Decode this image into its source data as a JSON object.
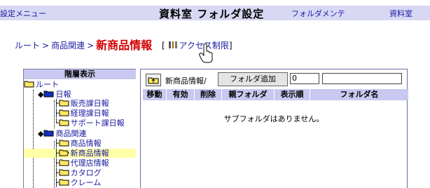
{
  "topbar": {
    "settings_menu": "設定メニュー",
    "title": "資料室 フォルダ設定",
    "folder_maint": "フォルダメンテ",
    "library": "資料室"
  },
  "breadcrumb": {
    "root": "ルート",
    "parent": "商品関連",
    "current": "新商品情報",
    "bracket_open": "[",
    "access": "アクセス制限",
    "bracket_close": "]"
  },
  "tree": {
    "header": "階層表示",
    "nodes": [
      "ルート",
      "日報",
      "販売課日報",
      "経理課日報",
      "サポート課日報",
      "商品関連",
      "商品情報",
      "新商品情報",
      "代理店情報",
      "カタログ",
      "クレーム"
    ]
  },
  "panel": {
    "path": "新商品情報/",
    "add_button": "フォルダ追加",
    "order_value": "0",
    "name_value": "",
    "columns": [
      "移動",
      "有効",
      "削除",
      "親フォルダ",
      "表示順",
      "フォルダ名"
    ],
    "empty_message": "サブフォルダはありません。"
  },
  "colors": {
    "topbar": "#d8d8f4",
    "link": "#1a1aa0",
    "current": "#d40000",
    "header": "#c8c8f0",
    "selected": "#ffffa8"
  }
}
